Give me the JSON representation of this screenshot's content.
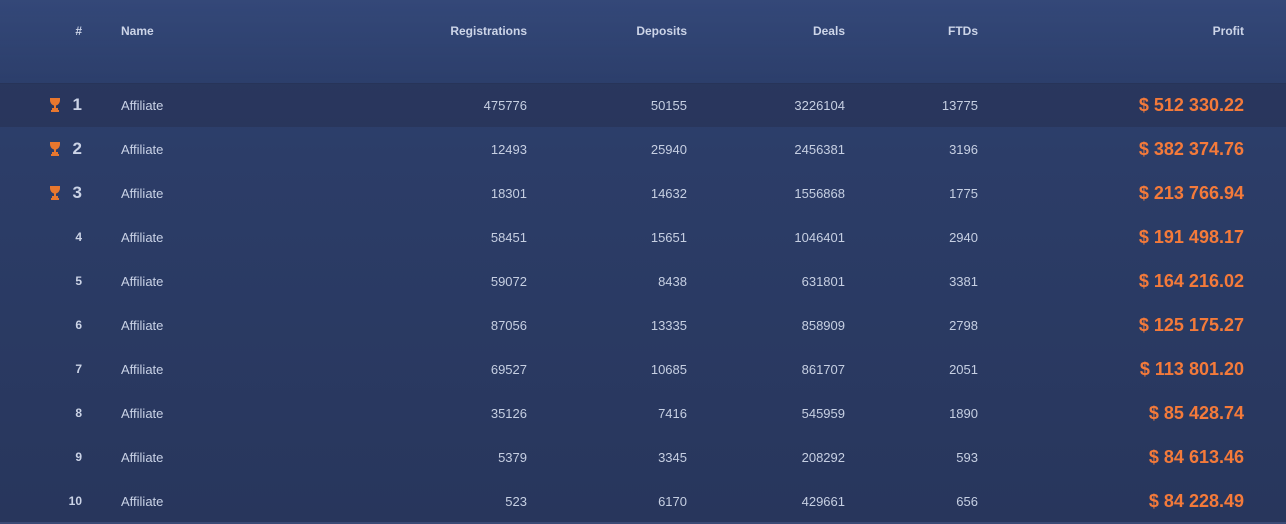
{
  "header": {
    "rank": "#",
    "name": "Name",
    "registrations": "Registrations",
    "deposits": "Deposits",
    "deals": "Deals",
    "ftds": "FTDs",
    "profit": "Profit"
  },
  "colors": {
    "profit": "#f47a3a",
    "trophy": "#e8772e"
  },
  "rows": [
    {
      "rank": "1",
      "name": "Affiliate",
      "registrations": "475776",
      "deposits": "50155",
      "deals": "3226104",
      "ftds": "13775",
      "profit": "$ 512 330.22",
      "trophy": true
    },
    {
      "rank": "2",
      "name": "Affiliate",
      "registrations": "12493",
      "deposits": "25940",
      "deals": "2456381",
      "ftds": "3196",
      "profit": "$ 382 374.76",
      "trophy": true
    },
    {
      "rank": "3",
      "name": "Affiliate",
      "registrations": "18301",
      "deposits": "14632",
      "deals": "1556868",
      "ftds": "1775",
      "profit": "$ 213 766.94",
      "trophy": true
    },
    {
      "rank": "4",
      "name": "Affiliate",
      "registrations": "58451",
      "deposits": "15651",
      "deals": "1046401",
      "ftds": "2940",
      "profit": "$ 191 498.17",
      "trophy": false
    },
    {
      "rank": "5",
      "name": "Affiliate",
      "registrations": "59072",
      "deposits": "8438",
      "deals": "631801",
      "ftds": "3381",
      "profit": "$ 164 216.02",
      "trophy": false
    },
    {
      "rank": "6",
      "name": "Affiliate",
      "registrations": "87056",
      "deposits": "13335",
      "deals": "858909",
      "ftds": "2798",
      "profit": "$ 125 175.27",
      "trophy": false
    },
    {
      "rank": "7",
      "name": "Affiliate",
      "registrations": "69527",
      "deposits": "10685",
      "deals": "861707",
      "ftds": "2051",
      "profit": "$ 113 801.20",
      "trophy": false
    },
    {
      "rank": "8",
      "name": "Affiliate",
      "registrations": "35126",
      "deposits": "7416",
      "deals": "545959",
      "ftds": "1890",
      "profit": "$ 85 428.74",
      "trophy": false
    },
    {
      "rank": "9",
      "name": "Affiliate",
      "registrations": "5379",
      "deposits": "3345",
      "deals": "208292",
      "ftds": "593",
      "profit": "$ 84 613.46",
      "trophy": false
    },
    {
      "rank": "10",
      "name": "Affiliate",
      "registrations": "523",
      "deposits": "6170",
      "deals": "429661",
      "ftds": "656",
      "profit": "$ 84 228.49",
      "trophy": false
    }
  ]
}
